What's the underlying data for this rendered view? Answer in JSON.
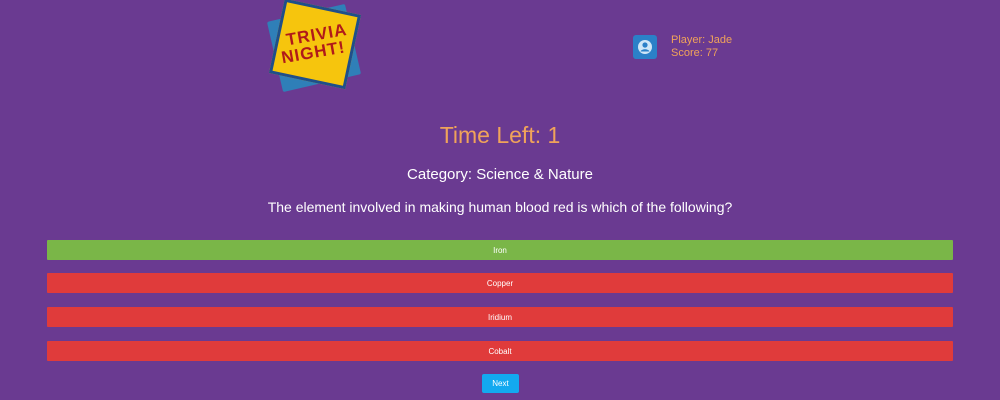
{
  "logo": {
    "line1": "TRIVIA",
    "line2": "NIGHT!"
  },
  "player": {
    "icon": "user-icon",
    "name_line": "Player: Jade",
    "score_line": "Score: 77"
  },
  "timer": {
    "text": "Time Left: 1"
  },
  "question": {
    "category_text": "Category: Science & Nature",
    "prompt": "The element involved in making human blood red is which of the following?"
  },
  "answers": [
    {
      "label": "Iron",
      "state": "correct",
      "color": "#7ab648"
    },
    {
      "label": "Copper",
      "state": "incorrect",
      "color": "#e03b3b"
    },
    {
      "label": "Iridium",
      "state": "incorrect",
      "color": "#e03b3b"
    },
    {
      "label": "Cobalt",
      "state": "incorrect",
      "color": "#e03b3b"
    }
  ],
  "next_button": {
    "label": "Next"
  },
  "colors": {
    "background": "#6a3a91",
    "accent_text": "#f0a35a",
    "next_button": "#13a9f0"
  }
}
